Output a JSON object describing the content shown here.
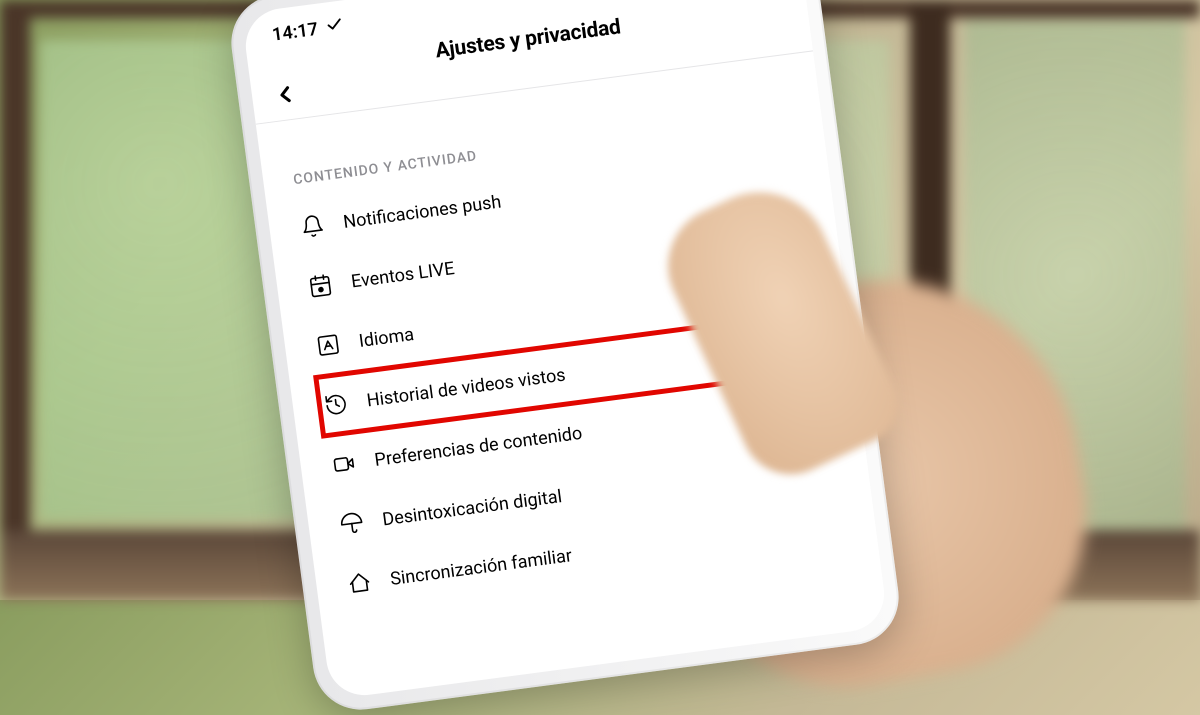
{
  "status": {
    "time": "14:17"
  },
  "header": {
    "title": "Ajustes y privacidad"
  },
  "section": {
    "title": "CONTENIDO Y ACTIVIDAD"
  },
  "items": [
    {
      "label": "Notificaciones push",
      "icon": "bell-icon",
      "highlighted": false
    },
    {
      "label": "Eventos LIVE",
      "icon": "calendar-icon",
      "highlighted": false
    },
    {
      "label": "Idioma",
      "icon": "language-icon",
      "highlighted": false
    },
    {
      "label": "Historial de videos vistos",
      "icon": "history-icon",
      "highlighted": true
    },
    {
      "label": "Preferencias de contenido",
      "icon": "video-icon",
      "highlighted": false
    },
    {
      "label": "Desintoxicación digital",
      "icon": "umbrella-icon",
      "highlighted": false
    },
    {
      "label": "Sincronización familiar",
      "icon": "home-icon",
      "highlighted": false
    }
  ],
  "colors": {
    "highlight": "#e10600",
    "text": "#000000",
    "secondaryText": "#8e8e93"
  }
}
